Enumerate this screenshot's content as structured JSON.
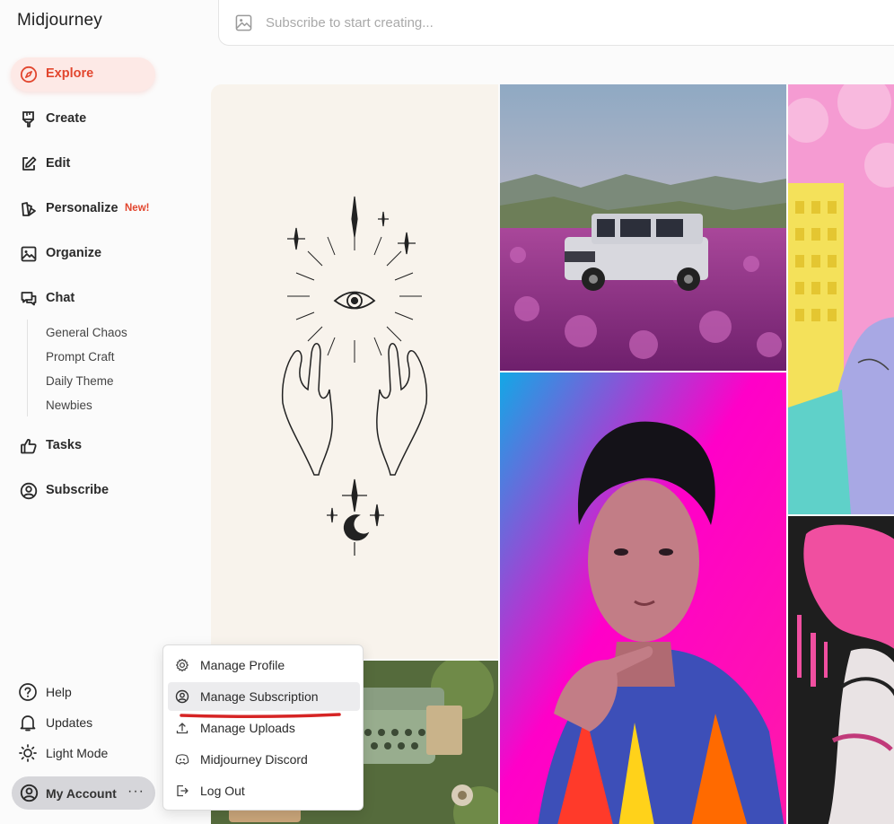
{
  "app": {
    "title": "Midjourney"
  },
  "search": {
    "placeholder": "Subscribe to start creating..."
  },
  "nav": [
    {
      "label": "Explore",
      "icon": "compass-icon",
      "active": true
    },
    {
      "label": "Create",
      "icon": "brush-icon"
    },
    {
      "label": "Edit",
      "icon": "edit-icon"
    },
    {
      "label": "Personalize",
      "icon": "personalize-icon",
      "badge": "New!"
    },
    {
      "label": "Organize",
      "icon": "image-icon"
    },
    {
      "label": "Chat",
      "icon": "chat-icon"
    },
    {
      "label": "Tasks",
      "icon": "thumbs-up-icon"
    },
    {
      "label": "Subscribe",
      "icon": "user-circle-icon"
    }
  ],
  "chat_rooms": [
    "General Chaos",
    "Prompt Craft",
    "Daily Theme",
    "Newbies"
  ],
  "bottom": [
    {
      "label": "Help",
      "icon": "help-icon"
    },
    {
      "label": "Updates",
      "icon": "bell-icon"
    },
    {
      "label": "Light Mode",
      "icon": "sun-icon"
    }
  ],
  "account": {
    "label": "My Account",
    "more": "···"
  },
  "menu": [
    {
      "label": "Manage Profile",
      "icon": "gear-icon"
    },
    {
      "label": "Manage Subscription",
      "icon": "user-circle-icon",
      "highlighted": true
    },
    {
      "label": "Manage Uploads",
      "icon": "upload-icon"
    },
    {
      "label": "Midjourney Discord",
      "icon": "discord-icon"
    },
    {
      "label": "Log Out",
      "icon": "logout-icon"
    }
  ],
  "colors": {
    "accent": "#e2462e",
    "accent_bg": "#fde9e6",
    "annotation": "#d62424"
  }
}
